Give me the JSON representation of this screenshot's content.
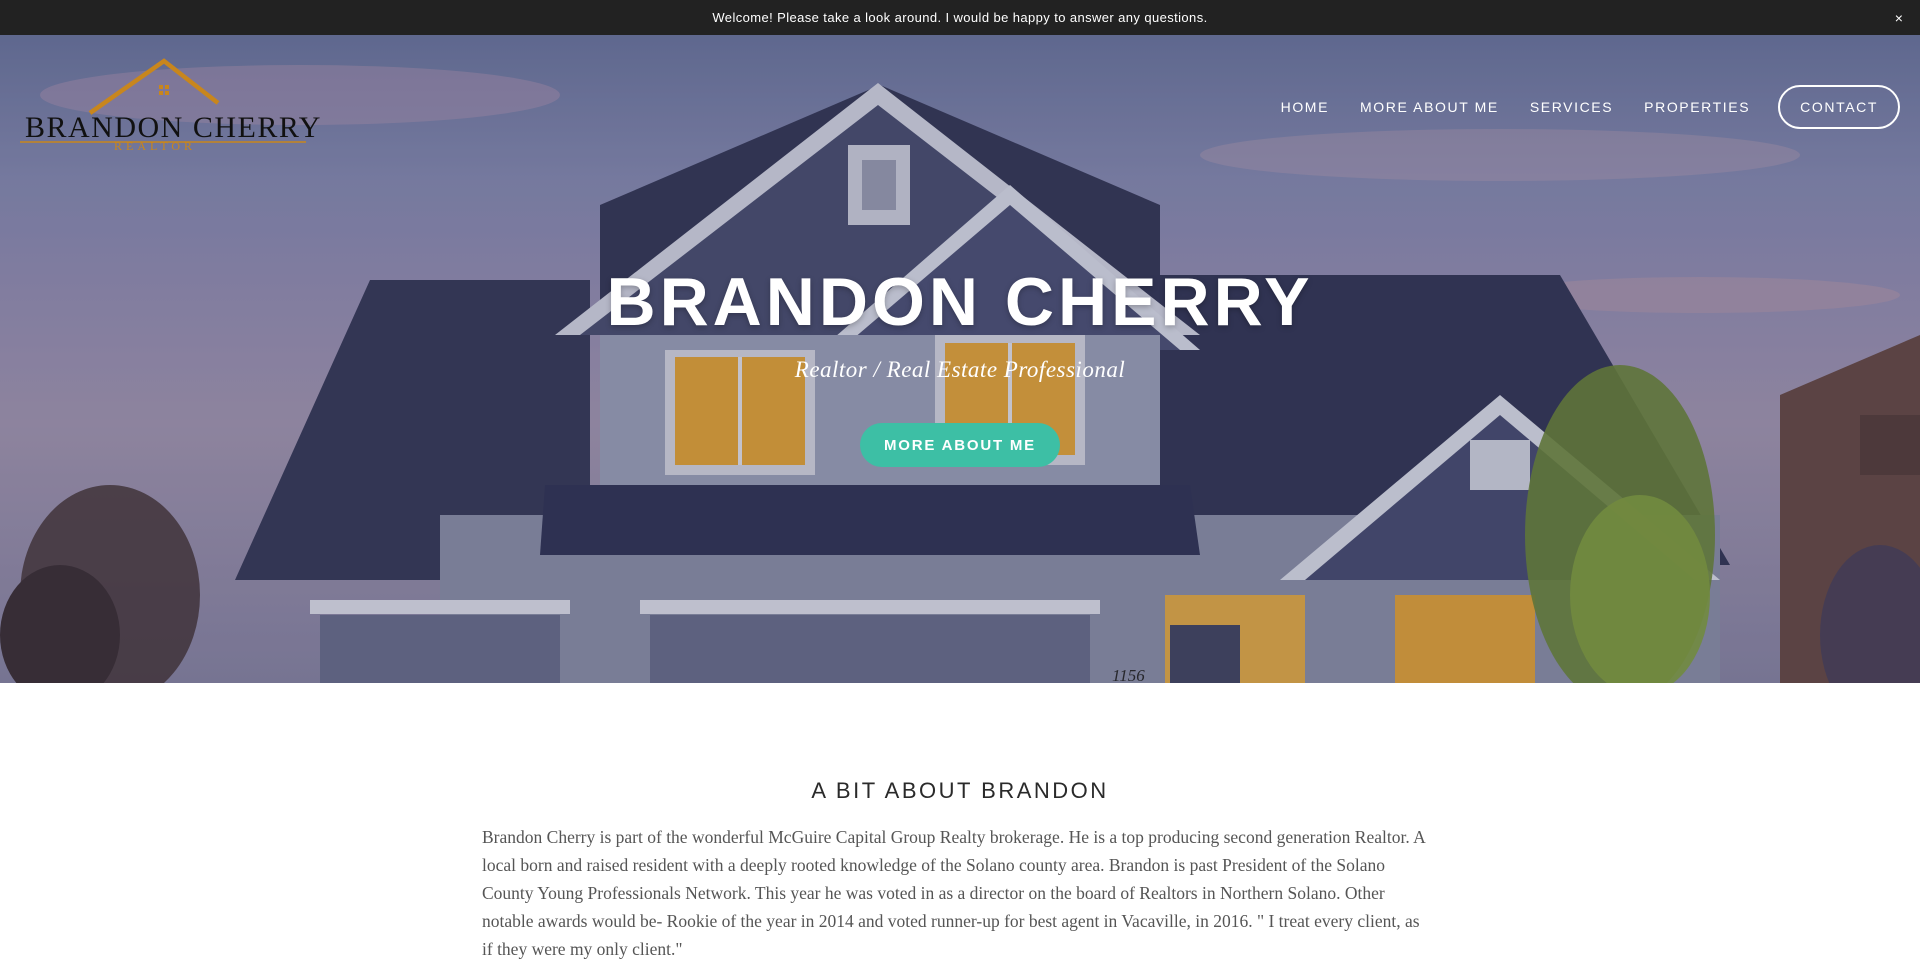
{
  "announcement": {
    "text": "Welcome! Please take a look around. I would be happy to answer any questions.",
    "close_glyph": "×"
  },
  "logo": {
    "name": "BRANDON CHERRY",
    "sub": "REALTOR",
    "icon": "house-roof-icon",
    "accent_color": "#c8861d"
  },
  "nav": {
    "items": [
      {
        "label": "HOME"
      },
      {
        "label": "MORE ABOUT ME"
      },
      {
        "label": "SERVICES"
      },
      {
        "label": "PROPERTIES"
      },
      {
        "label": "CONTACT"
      }
    ]
  },
  "hero": {
    "title": "BRANDON CHERRY",
    "subtitle": "Realtor / Real Estate Professional",
    "button_label": "MORE ABOUT ME",
    "button_color": "#3dbfa5",
    "house_number": "1156"
  },
  "about": {
    "title": "A BIT ABOUT BRANDON",
    "text": " Brandon Cherry is part of the wonderful McGuire Capital Group Realty brokerage. He is a top producing second generation Realtor. A local born and raised resident with a deeply rooted knowledge of the Solano county area. Brandon is past President of the Solano County Young Professionals Network. This year he was voted in as a director on the board of Realtors in Northern Solano. Other notable awards would be- Rookie of the year in 2014 and voted runner-up for best agent in Vacaville, in 2016. \" I treat every client, as if they were my only client.\""
  },
  "colors": {
    "announce_bg": "#222222",
    "body_text": "#555555",
    "heading_text": "#2a2a2a"
  }
}
